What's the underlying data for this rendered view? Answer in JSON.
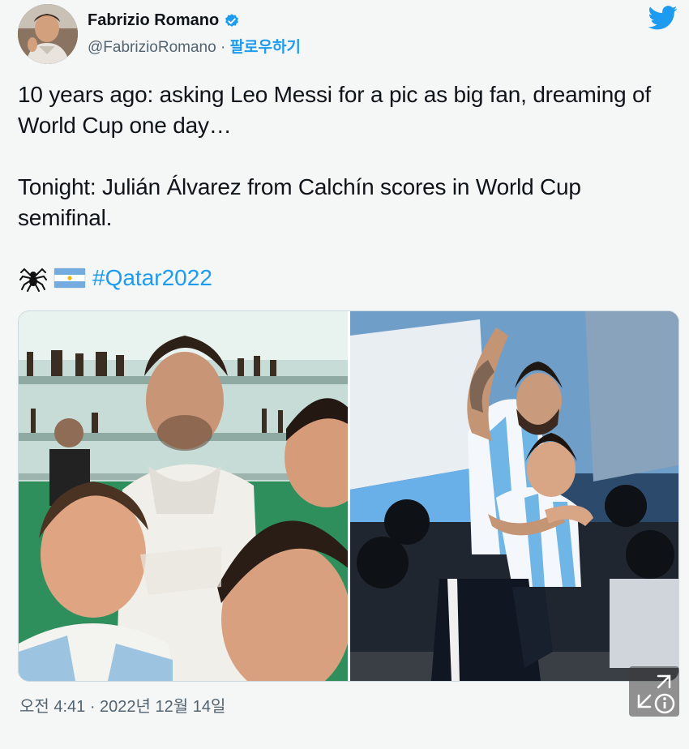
{
  "author": {
    "display_name": "Fabrizio Romano",
    "handle": "@FabrizioRomano",
    "separator": " · ",
    "follow_label": "팔로우하기"
  },
  "tweet": {
    "paragraphs": [
      "10 years ago: asking Leo Messi for a pic as big fan, dreaming of World Cup one day…",
      "Tonight: Julián Álvarez from Calchín scores in World Cup semifinal."
    ],
    "emojis": [
      "spider-icon",
      "argentina-flag-icon"
    ],
    "hashtag": "#Qatar2022",
    "timestamp": "오전 4:41 · 2022년 12월 14일"
  },
  "colors": {
    "accent": "#1d9bf0",
    "muted": "#536471",
    "text": "#0f1419"
  }
}
